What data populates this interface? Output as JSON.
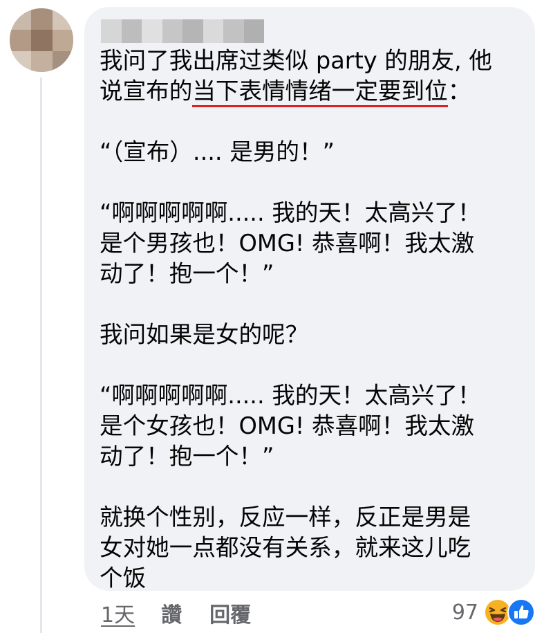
{
  "comment": {
    "lines": [
      "我问了我出席过类似 party 的朋友, 他",
      "说宣布的",
      "当下表情情绪一定要到位",
      "：",
      "“（宣布）.... 是男的！”",
      "“啊啊啊啊啊..... 我的天！太高兴了！",
      "是个男孩也！OMG! 恭喜啊！我太激",
      "动了！抱一个！”",
      "我问如果是女的呢？",
      "“啊啊啊啊啊..... 我的天！太高兴了！",
      "是个女孩也！OMG! 恭喜啊！我太激",
      "动了！抱一个！”",
      "就换个性别，反应一样，反正是男是",
      "女对她一点都没有关系，就来这儿吃",
      "个饭"
    ]
  },
  "actions": {
    "time": "1天",
    "like": "讚",
    "reply": "回覆"
  },
  "reactions": {
    "count": "97",
    "icons": [
      "haha-icon",
      "like-icon"
    ]
  },
  "colors": {
    "bubble": "#f0f2f5",
    "text": "#050505",
    "meta": "#65676b",
    "underline": "#e02020",
    "like_blue": "#1877f2",
    "haha_yellow": "#f7b125"
  }
}
